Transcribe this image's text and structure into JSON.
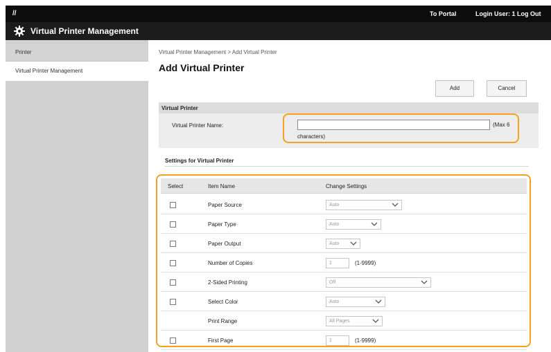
{
  "topbar": {
    "slashes": "//",
    "portal_link": "To Portal",
    "login_text": "Login User: 1 Log Out"
  },
  "titlebar": {
    "title": "Virtual Printer Management",
    "icon": "gear-icon"
  },
  "sidebar": {
    "items": [
      {
        "label": "Printer"
      },
      {
        "label": "Virtual Printer Management",
        "selected": true
      }
    ]
  },
  "main": {
    "breadcrumb": "Virtual Printer Management > Add Virtual Printer",
    "title": "Add Virtual Printer",
    "add_label": "Add",
    "cancel_label": "Cancel",
    "virtual_printer": {
      "header": "Virtual Printer",
      "name_label": "Virtual Printer Name:",
      "name_value": "",
      "hint_part1": "(Max 6",
      "hint_part2": "characters)"
    },
    "settings": {
      "title": "Settings for Virtual Printer",
      "columns": [
        "Select",
        "Item Name",
        "Change Settings"
      ],
      "rows": [
        {
          "name": "Paper Source",
          "control": "select",
          "value": "Auto"
        },
        {
          "name": "Paper Type",
          "control": "select",
          "value": "Auto"
        },
        {
          "name": "Paper Output",
          "control": "select",
          "value": "Auto"
        },
        {
          "name": "Number of Copies",
          "control": "number",
          "value": "1",
          "range": "(1-9999)"
        },
        {
          "name": "2-Sided Printing",
          "control": "select",
          "value": "Off"
        },
        {
          "name": "Select Color",
          "control": "select",
          "value": "Auto"
        },
        {
          "name": "Print Range",
          "control": "select",
          "value": "All Pages",
          "no_checkbox": true
        },
        {
          "name": "First Page",
          "control": "number",
          "value": "1",
          "range": "(1-9999)"
        }
      ]
    }
  },
  "colors": {
    "highlight": "#f2a21e",
    "topbar": "#0d0d0d",
    "sidebar": "#d0d0d0"
  }
}
